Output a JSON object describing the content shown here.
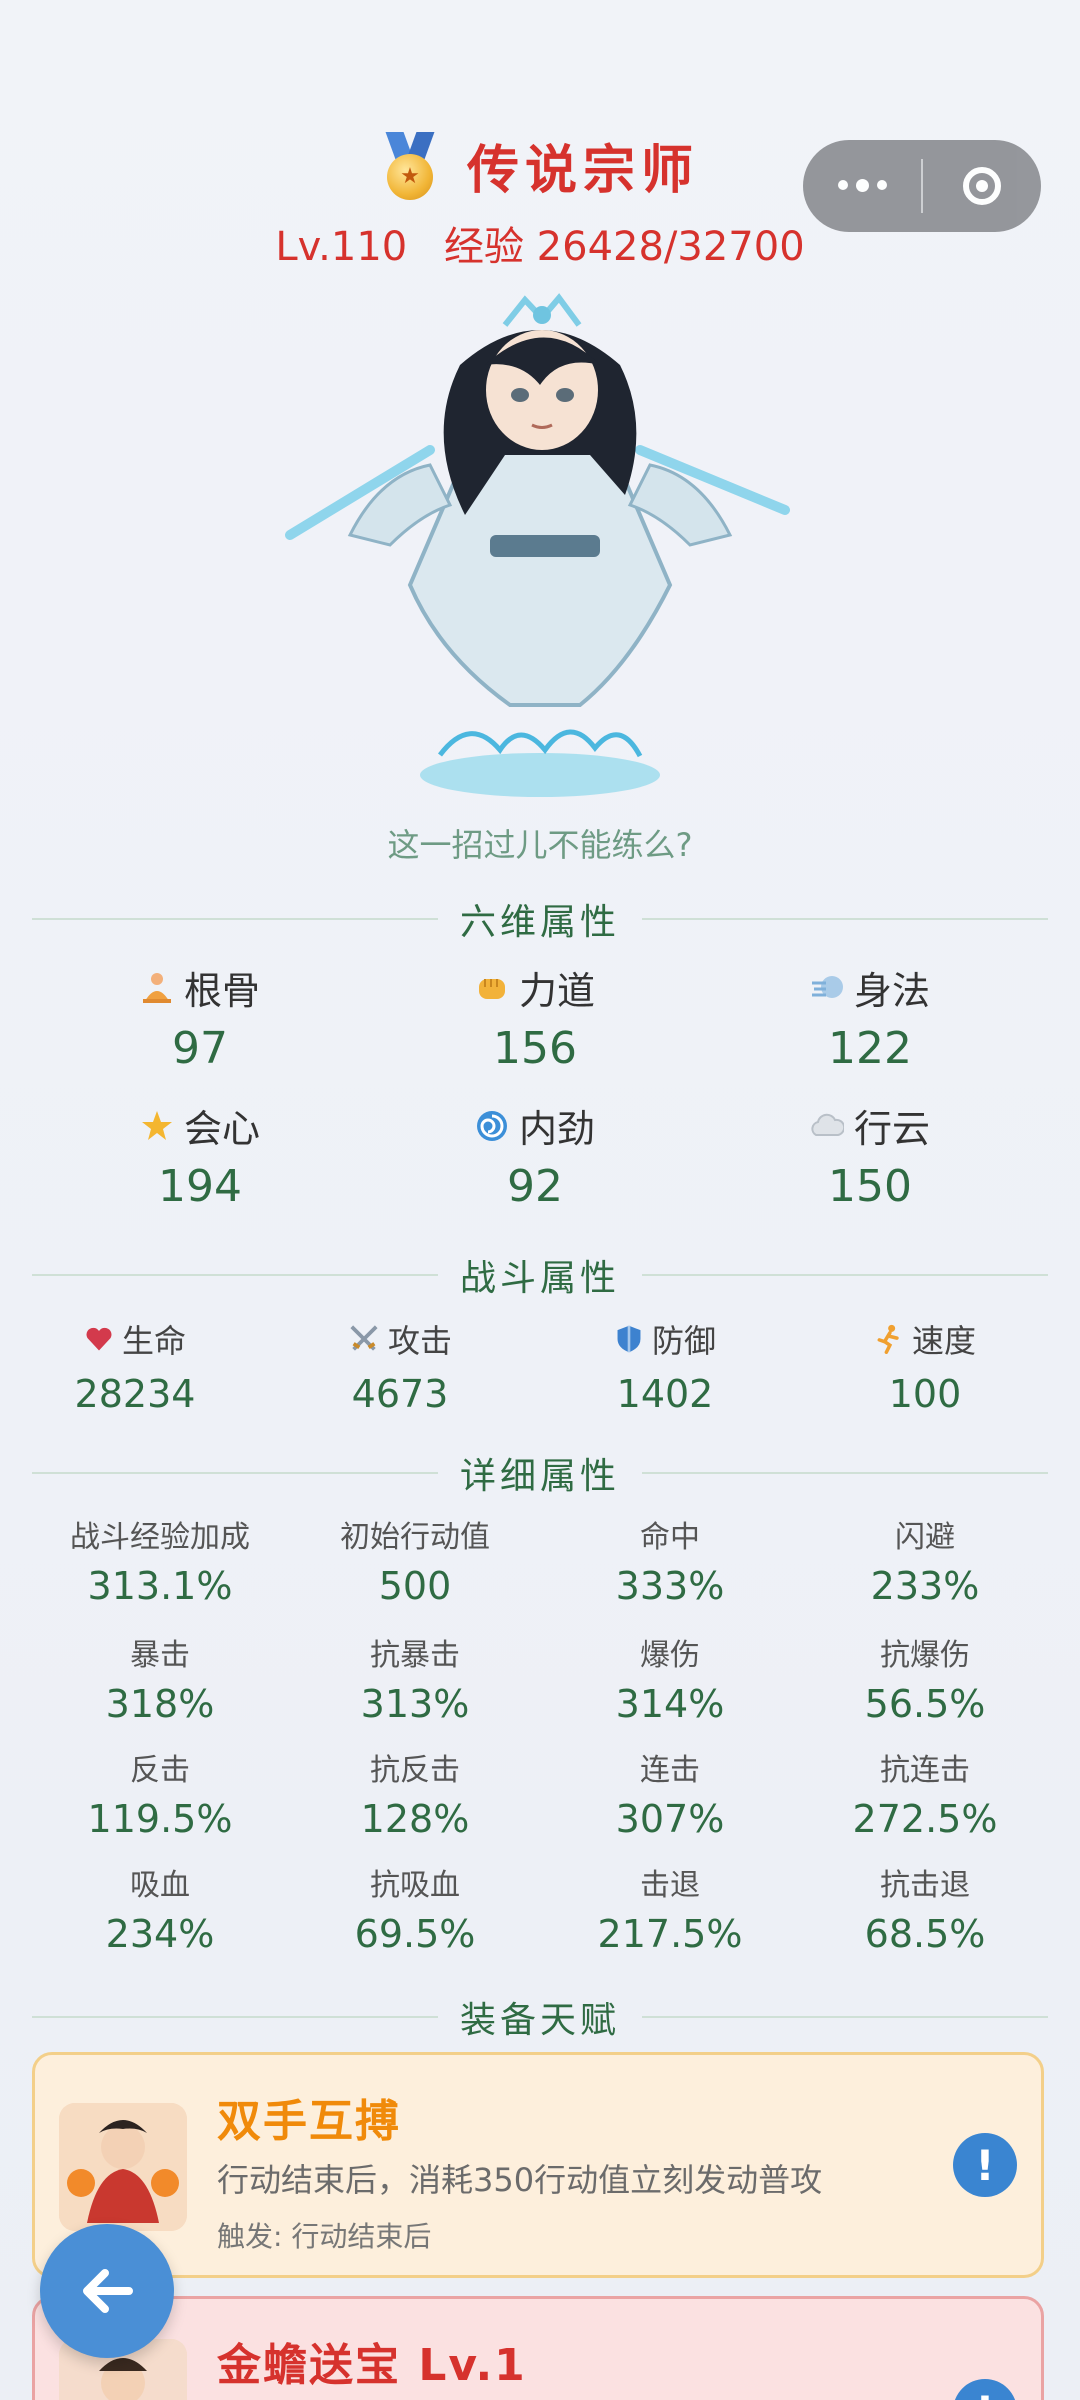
{
  "header": {
    "rank_title": "传说宗师",
    "level": "Lv.110",
    "exp": "经验 26428/32700"
  },
  "hero": {
    "quote": "这一招过儿不能练么?"
  },
  "six_attrs": {
    "title": "六维属性",
    "items": [
      {
        "label": "根骨",
        "value": "97",
        "icon": "meditation-icon"
      },
      {
        "label": "力道",
        "value": "156",
        "icon": "fist-icon"
      },
      {
        "label": "身法",
        "value": "122",
        "icon": "wind-icon"
      },
      {
        "label": "会心",
        "value": "194",
        "icon": "star-icon"
      },
      {
        "label": "内劲",
        "value": "92",
        "icon": "swirl-icon"
      },
      {
        "label": "行云",
        "value": "150",
        "icon": "cloud-icon"
      }
    ]
  },
  "battle_attrs": {
    "title": "战斗属性",
    "items": [
      {
        "label": "生命",
        "value": "28234",
        "icon": "heart-icon"
      },
      {
        "label": "攻击",
        "value": "4673",
        "icon": "crossed-swords-icon"
      },
      {
        "label": "防御",
        "value": "1402",
        "icon": "shield-icon"
      },
      {
        "label": "速度",
        "value": "100",
        "icon": "runner-icon"
      }
    ]
  },
  "detail_attrs": {
    "title": "详细属性",
    "items": [
      {
        "label": "战斗经验加成",
        "value": "313.1%"
      },
      {
        "label": "初始行动值",
        "value": "500"
      },
      {
        "label": "命中",
        "value": "333%"
      },
      {
        "label": "闪避",
        "value": "233%"
      },
      {
        "label": "暴击",
        "value": "318%"
      },
      {
        "label": "抗暴击",
        "value": "313%"
      },
      {
        "label": "爆伤",
        "value": "314%"
      },
      {
        "label": "抗爆伤",
        "value": "56.5%"
      },
      {
        "label": "反击",
        "value": "119.5%"
      },
      {
        "label": "抗反击",
        "value": "128%"
      },
      {
        "label": "连击",
        "value": "307%"
      },
      {
        "label": "抗连击",
        "value": "272.5%"
      },
      {
        "label": "吸血",
        "value": "234%"
      },
      {
        "label": "抗吸血",
        "value": "69.5%"
      },
      {
        "label": "击退",
        "value": "217.5%"
      },
      {
        "label": "抗击退",
        "value": "68.5%"
      }
    ]
  },
  "talents": {
    "title": "装备天赋",
    "items": [
      {
        "name": "双手互搏",
        "desc": "行动结束后，消耗350行动值立刻发动普攻",
        "trigger": "触发: 行动结束后",
        "info": "!"
      },
      {
        "name": "金蟾送宝  Lv.1",
        "info": "!"
      }
    ]
  },
  "colors": {
    "accent_red": "#d6322d",
    "value_green": "#2f6b43",
    "talent_orange": "#f08a0a",
    "info_blue": "#3a85d1"
  }
}
